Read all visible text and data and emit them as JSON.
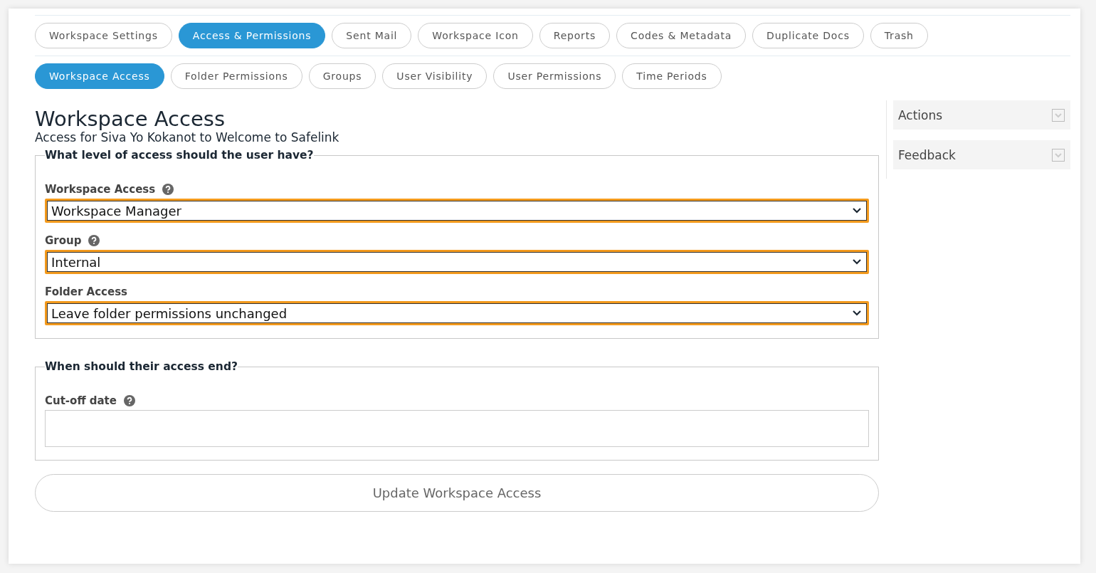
{
  "main_tabs": [
    {
      "label": "Workspace Settings",
      "selected": false
    },
    {
      "label": "Access & Permissions",
      "selected": true
    },
    {
      "label": "Sent Mail",
      "selected": false
    },
    {
      "label": "Workspace Icon",
      "selected": false
    },
    {
      "label": "Reports",
      "selected": false
    },
    {
      "label": "Codes & Metadata",
      "selected": false
    },
    {
      "label": "Duplicate Docs",
      "selected": false
    },
    {
      "label": "Trash",
      "selected": false
    }
  ],
  "sub_tabs": [
    {
      "label": "Workspace Access",
      "selected": true
    },
    {
      "label": "Folder Permissions",
      "selected": false
    },
    {
      "label": "Groups",
      "selected": false
    },
    {
      "label": "User Visibility",
      "selected": false
    },
    {
      "label": "User Permissions",
      "selected": false
    },
    {
      "label": "Time Periods",
      "selected": false
    }
  ],
  "page": {
    "title": "Workspace Access",
    "subtitle": "Access for Siva Yo Kokanot to Welcome to Safelink"
  },
  "sections": [
    {
      "legend": "What level of access should the user have?",
      "fields": [
        {
          "label": "Workspace Access",
          "help": true,
          "kind": "select",
          "value": "Workspace Manager"
        },
        {
          "label": "Group",
          "help": true,
          "kind": "select",
          "value": "Internal"
        },
        {
          "label": "Folder Access",
          "help": false,
          "kind": "select",
          "value": "Leave folder permissions unchanged"
        }
      ]
    },
    {
      "legend": "When should their access end?",
      "fields": [
        {
          "label": "Cut-off date",
          "help": true,
          "kind": "text"
        }
      ]
    }
  ],
  "submit": "Update Workspace Access",
  "sidebar": [
    {
      "title": "Actions",
      "expanded": false
    },
    {
      "title": "Feedback",
      "expanded": false
    }
  ]
}
